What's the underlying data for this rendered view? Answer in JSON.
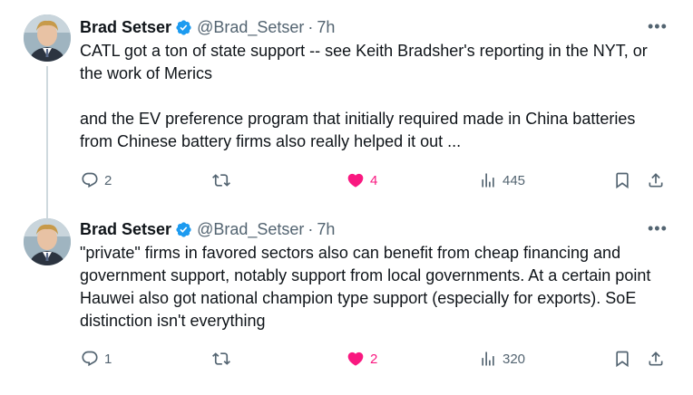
{
  "tweets": [
    {
      "author_name": "Brad Setser",
      "handle": "@Brad_Setser",
      "separator": "·",
      "time": "7h",
      "paragraphs": [
        "CATL got a ton of state support --  see Keith Bradsher's reporting in the NYT, or the work of Merics",
        "and the EV preference program that initially required made in China batteries from Chinese battery firms also really helped it out ..."
      ],
      "more_label": "•••",
      "replies": "2",
      "retweets": "",
      "likes": "4",
      "liked": true,
      "views": "445"
    },
    {
      "author_name": "Brad Setser",
      "handle": "@Brad_Setser",
      "separator": "·",
      "time": "7h",
      "paragraphs": [
        "\"private\" firms in favored sectors also can benefit from cheap financing and government support, notably support from local governments.   At a certain point Hauwei also got national champion type support (especially for exports).  SoE distinction isn't everything"
      ],
      "more_label": "•••",
      "replies": "1",
      "retweets": "",
      "likes": "2",
      "liked": true,
      "views": "320"
    }
  ],
  "colors": {
    "text": "#0f1419",
    "muted": "#536471",
    "like": "#f91880",
    "verified": "#1d9bf0",
    "thread_line": "#cfd9de"
  },
  "icons": [
    "reply-icon",
    "retweet-icon",
    "heart-icon",
    "views-icon",
    "bookmark-icon",
    "share-icon",
    "verified-badge-icon",
    "more-options-icon"
  ]
}
